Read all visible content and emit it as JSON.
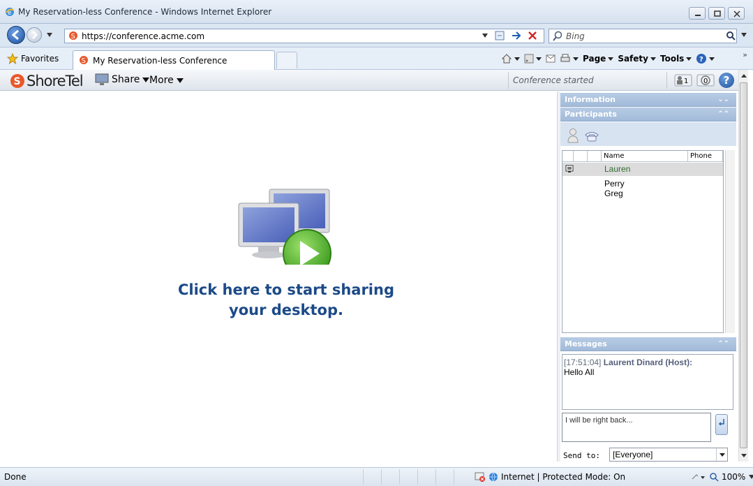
{
  "window": {
    "title": "My Reservation-less Conference - Windows Internet Explorer"
  },
  "address": {
    "url": "https://conference.acme.com",
    "search_placeholder": "Bing"
  },
  "favorites": {
    "label": "Favorites"
  },
  "tab": {
    "label": "My Reservation-less Conference"
  },
  "commands": {
    "page": "Page",
    "safety": "Safety",
    "tools": "Tools"
  },
  "app": {
    "brand": "ShoreTel",
    "share_label": "Share",
    "more_label": "More",
    "status": "Conference started",
    "participant_count": "1",
    "call_count": "0",
    "help": "?"
  },
  "main": {
    "line1": "Click here to start sharing",
    "line2": "your desktop."
  },
  "panel": {
    "information": "Information",
    "participants": "Participants",
    "col_name": "Name",
    "col_phone": "Phone",
    "people": [
      "Lauren",
      "Perry",
      "Greg"
    ],
    "messages": "Messages",
    "msg_time": "[17:51:04]",
    "msg_sender": "Laurent Dinard (Host):",
    "msg_text": "Hello All",
    "input_value": "I will be right back...",
    "send_to_label": "Send to:",
    "send_to_value": "[Everyone]"
  },
  "status": {
    "done": "Done",
    "zone": "Internet | Protected Mode: On",
    "zoom": "100%"
  }
}
